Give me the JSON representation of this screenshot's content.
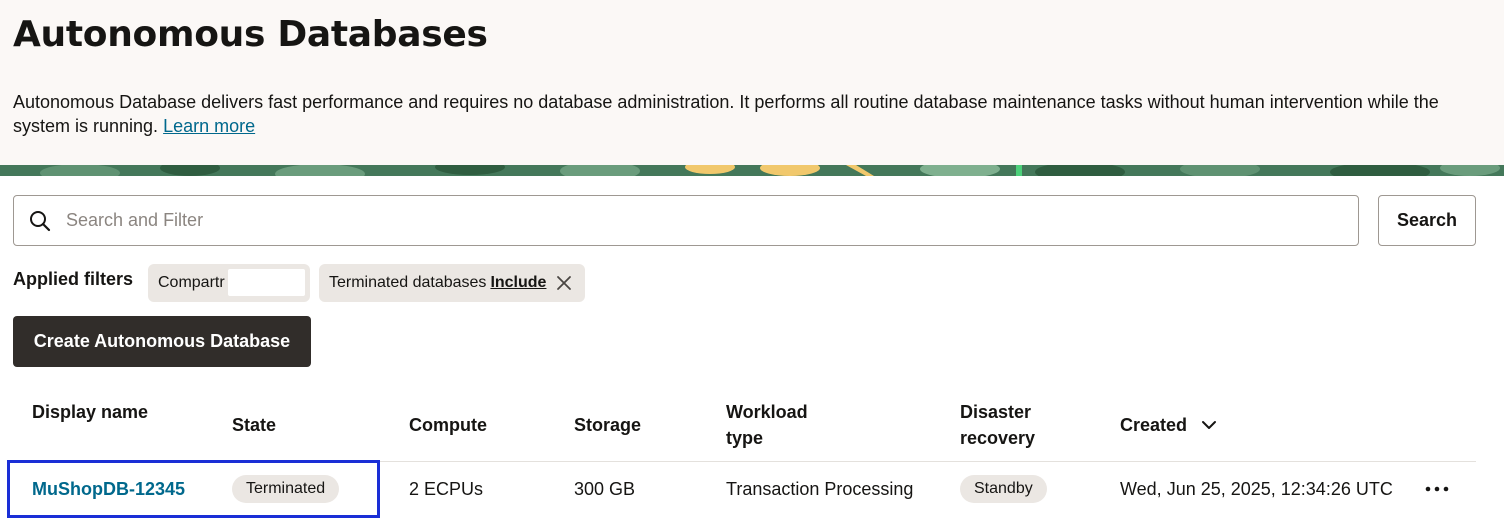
{
  "header": {
    "title": "Autonomous Databases",
    "description": "Autonomous Database delivers fast performance and requires no database administration. It performs all routine database maintenance tasks without human intervention while the system is running.",
    "learn_more": "Learn more"
  },
  "search": {
    "placeholder": "Search and Filter",
    "value": "",
    "button_label": "Search"
  },
  "filters": {
    "label": "Applied filters",
    "chips": [
      {
        "text": "Compartr"
      },
      {
        "text": "Terminated databases",
        "action": "Include"
      }
    ]
  },
  "actions": {
    "create_label": "Create Autonomous Database"
  },
  "table": {
    "columns": [
      "Display name",
      "State",
      "Compute",
      "Storage",
      "Workload type",
      "Disaster recovery",
      "Created"
    ],
    "sorted_column": "Created",
    "rows": [
      {
        "display_name": "MuShopDB-12345",
        "state": "Terminated",
        "compute": "2 ECPUs",
        "storage": "300 GB",
        "workload_type": "Transaction Processing",
        "disaster_recovery": "Standby",
        "created": "Wed, Jun 25, 2025, 12:34:26 UTC"
      }
    ]
  },
  "colors": {
    "link": "#00688c",
    "primary_button": "#312d2a",
    "header_bg": "#fbf8f6",
    "chip_bg": "#ebe7e3",
    "focus_outline": "#1a2fd6"
  }
}
